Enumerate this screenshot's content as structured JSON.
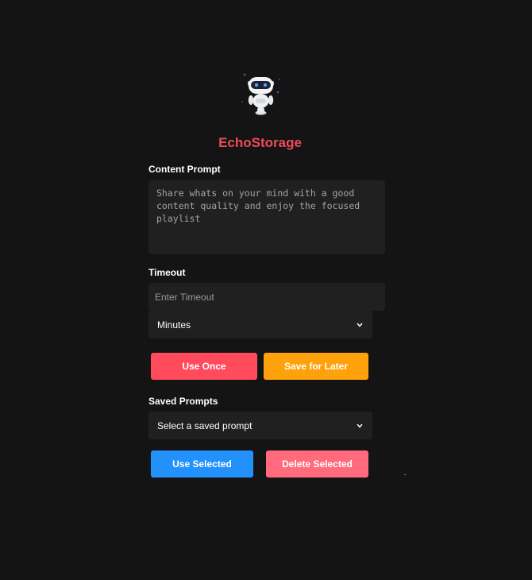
{
  "app": {
    "title": "EchoStorage",
    "logo_icon": "robot-icon"
  },
  "content_prompt": {
    "label": "Content Prompt",
    "placeholder": "Share whats on your mind with a good content quality and enjoy the focused playlist",
    "value": ""
  },
  "timeout": {
    "label": "Timeout",
    "placeholder": "Enter Timeout",
    "value": "",
    "unit_selected": "Minutes"
  },
  "actions": {
    "use_once": "Use Once",
    "save_for_later": "Save for Later"
  },
  "saved_prompts": {
    "label": "Saved Prompts",
    "selected": "Select a saved prompt",
    "use_selected": "Use Selected",
    "delete_selected": "Delete Selected"
  },
  "colors": {
    "background": "#141414",
    "field": "#202020",
    "title": "#ee4b5a",
    "use_once": "#ff4b5c",
    "save_for_later": "#ffa10a",
    "use_selected": "#2291fb",
    "delete_selected": "#ff6a7d"
  }
}
